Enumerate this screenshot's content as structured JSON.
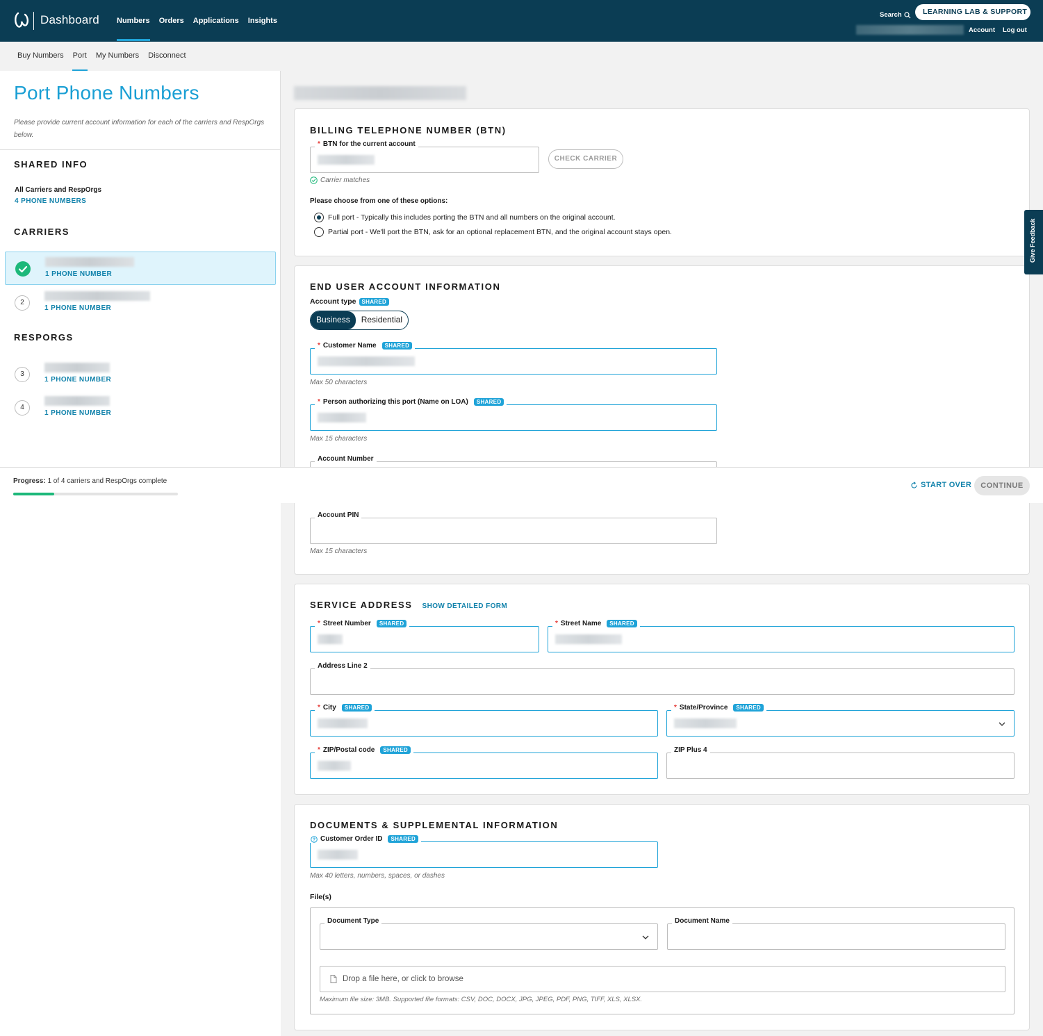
{
  "app": {
    "title": "Dashboard",
    "nav": [
      "Numbers",
      "Orders",
      "Applications",
      "Insights"
    ],
    "search_label": "Search",
    "learning_lab_label": "LEARNING LAB & SUPPORT",
    "account_label": "Account",
    "logout_label": "Log out"
  },
  "subnav": [
    "Buy Numbers",
    "Port",
    "My Numbers",
    "Disconnect"
  ],
  "left": {
    "title": "Port Phone Numbers",
    "description": "Please provide current account information for each of the carriers and RespOrgs below.",
    "shared_info_heading": "SHARED INFO",
    "all_carriers_label": "All Carriers and RespOrgs",
    "all_carriers_count": "4 PHONE NUMBERS",
    "carriers_heading": "CARRIERS",
    "resporgs_heading": "RESPORGS",
    "carriers": [
      {
        "index": "1",
        "count": "1 PHONE NUMBER",
        "done": true
      },
      {
        "index": "2",
        "count": "1 PHONE NUMBER",
        "done": false
      }
    ],
    "resporgs": [
      {
        "index": "3",
        "count": "1 PHONE NUMBER"
      },
      {
        "index": "4",
        "count": "1 PHONE NUMBER"
      }
    ]
  },
  "btn": {
    "heading": "BILLING TELEPHONE NUMBER (BTN)",
    "field_label": "BTN for the current account",
    "check_carrier": "CHECK CARRIER",
    "carrier_matches": "Carrier matches",
    "options_prompt": "Please choose from one of these options:",
    "option_full": "Full port - Typically this includes porting the BTN and all numbers on the original account.",
    "option_partial": "Partial port - We'll port the BTN, ask for an optional replacement BTN, and the original account stays open."
  },
  "end_user": {
    "heading": "END USER ACCOUNT INFORMATION",
    "account_type_label": "Account type",
    "shared_badge": "SHARED",
    "toggle": [
      "Business",
      "Residential"
    ],
    "customer_name_label": "Customer Name",
    "customer_name_hint": "Max 50 characters",
    "authorizer_label": "Person authorizing this port (Name on LOA)",
    "authorizer_hint": "Max 15 characters",
    "account_number_label": "Account Number",
    "account_pin_label": "Account PIN",
    "account_pin_hint": "Max 15 characters"
  },
  "progress": {
    "label": "Progress:",
    "text": "1 of 4 carriers and RespOrgs complete",
    "value": 0.25,
    "start_over": "START OVER",
    "continue": "CONTINUE"
  },
  "service_address": {
    "heading": "SERVICE ADDRESS",
    "detail_link": "SHOW DETAILED FORM",
    "street_number": "Street Number",
    "street_name": "Street Name",
    "address_line_2": "Address Line 2",
    "city": "City",
    "state": "State/Province",
    "zip": "ZIP/Postal code",
    "zip_plus_4": "ZIP Plus 4"
  },
  "documents": {
    "heading": "DOCUMENTS & SUPPLEMENTAL INFORMATION",
    "order_id_label": "Customer Order ID",
    "order_id_hint": "Max 40 letters, numbers, spaces, or dashes",
    "files_label": "File(s)",
    "doc_type_label": "Document Type",
    "doc_name_label": "Document Name",
    "dropzone_text": "Drop a file here, or click to browse",
    "file_hint": "Maximum file size: 3MB. Supported file formats: CSV, DOC, DOCX, JPG, JPEG, PDF, PNG, TIFF, XLS, XLSX."
  },
  "feedback_label": "Give Feedback",
  "colors": {
    "brand_dark": "#0b3d54",
    "accent": "#1fa3d8",
    "success": "#1db87a"
  }
}
